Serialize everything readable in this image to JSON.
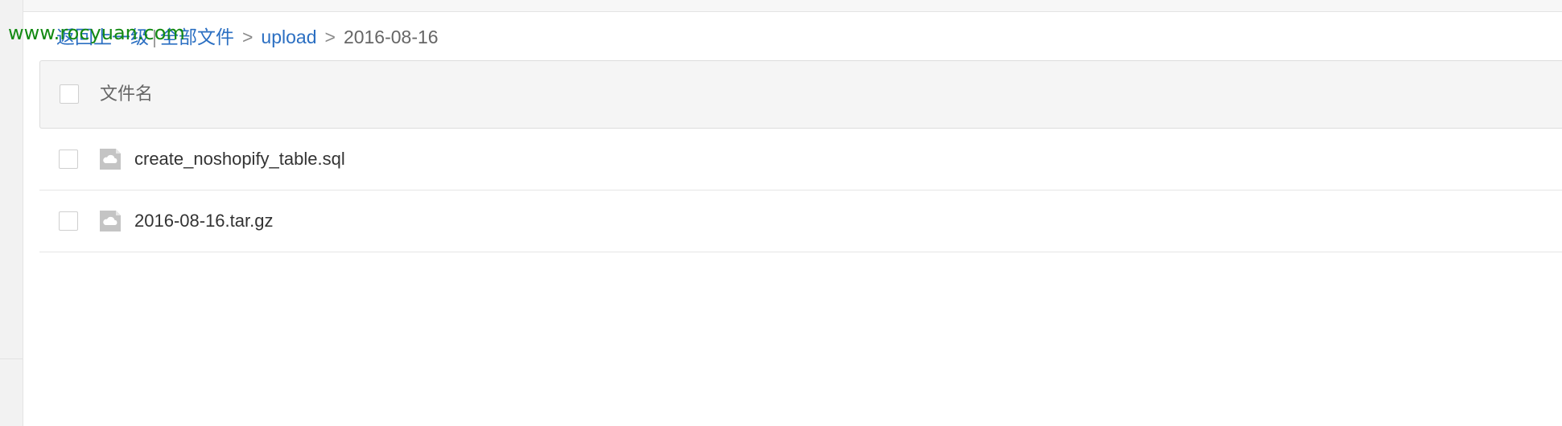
{
  "watermark": "www.rocyuan.com",
  "breadcrumb": {
    "back_label": "返回上一级",
    "pipe": "|",
    "root_label": "全部文件",
    "sep1": ">",
    "folder_label": "upload",
    "sep2": ">",
    "current_label": "2016-08-16"
  },
  "table": {
    "header_label": "文件名",
    "files": [
      {
        "name": "create_noshopify_table.sql",
        "icon": "file-cloud-icon"
      },
      {
        "name": "2016-08-16.tar.gz",
        "icon": "file-cloud-icon"
      }
    ]
  },
  "colors": {
    "link": "#2b6fc2",
    "watermark": "#138a13",
    "header_bg": "#f5f5f5"
  }
}
